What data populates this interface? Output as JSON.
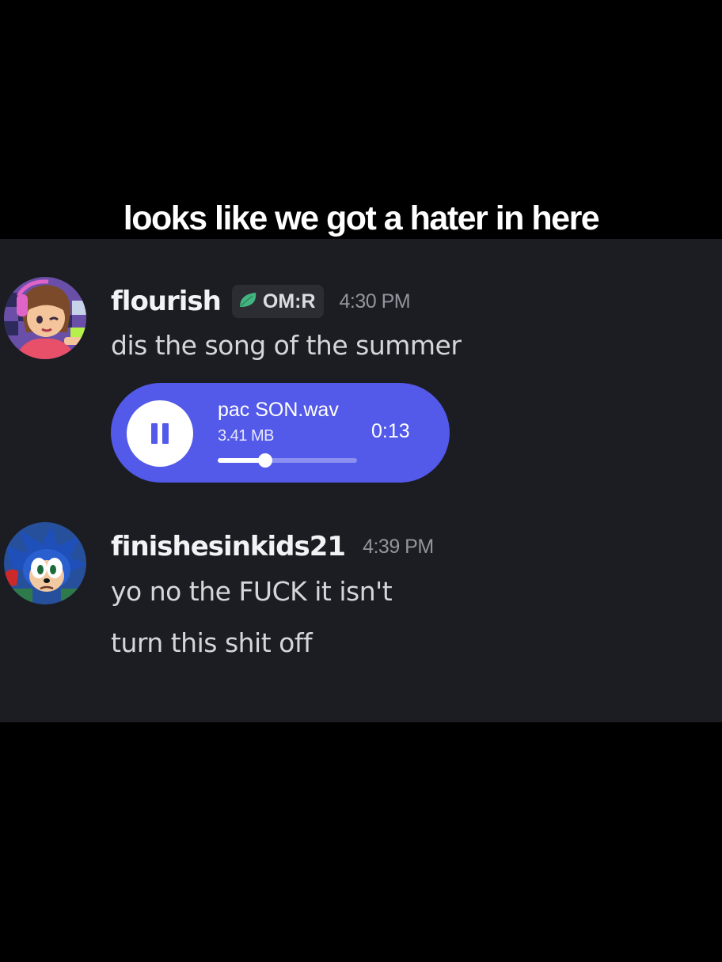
{
  "caption": "looks like we got a hater in here",
  "colors": {
    "background": "#000000",
    "chat_background": "#1c1d22",
    "player_accent": "#5359e8",
    "tag_background": "#2b2d33",
    "tag_leaf": "#43b581"
  },
  "messages": [
    {
      "username": "flourish",
      "tag": {
        "icon": "leaf-icon",
        "label": "OM:R"
      },
      "timestamp": "4:30 PM",
      "text": "dis the song of the summer",
      "attachment": {
        "type": "voice-player",
        "icon": "pause-icon",
        "file_name": "pac SON.wav",
        "file_size": "3.41 MB",
        "duration": "0:13",
        "progress": 0.34
      }
    },
    {
      "username": "finishesinkids21",
      "timestamp": "4:39 PM",
      "lines": [
        "yo no the FUCK it isn't",
        "turn this shit off"
      ]
    }
  ]
}
